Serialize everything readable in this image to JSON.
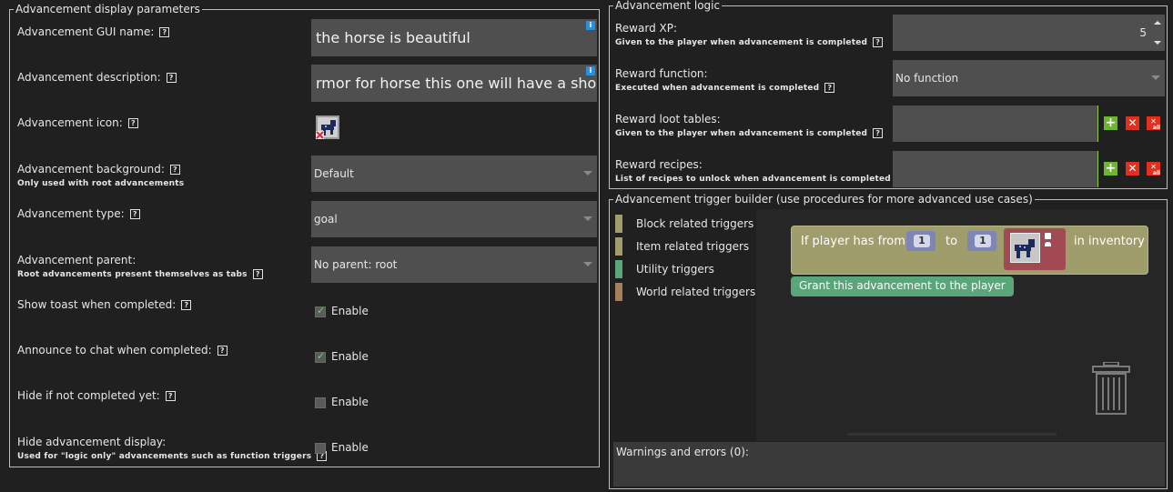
{
  "left_panel": {
    "title": "Advancement display parameters",
    "help_glyph": "?",
    "info_glyph": "i",
    "gui_name": {
      "label": "Advancement GUI name:",
      "value": "the horse is beautiful"
    },
    "description": {
      "label": "Advancement description:",
      "value": "rmor for horse this one will have a short life"
    },
    "icon": {
      "label": "Advancement icon:"
    },
    "background": {
      "label": "Advancement background:",
      "sub": "Only used with root advancements",
      "value": "Default"
    },
    "type": {
      "label": "Advancement type:",
      "value": "goal"
    },
    "parent": {
      "label": "Advancement parent:",
      "sub": "Root advancements present themselves as tabs",
      "value": "No parent: root"
    },
    "show_toast": {
      "label": "Show toast when completed:",
      "check_label": "Enable",
      "checked": true
    },
    "announce_chat": {
      "label": "Announce to chat when completed:",
      "check_label": "Enable",
      "checked": true
    },
    "hide_not_completed": {
      "label": "Hide if not completed yet:",
      "check_label": "Enable",
      "checked": false
    },
    "hide_display": {
      "label": "Hide advancement display:",
      "sub": "Used for \"logic only\" advancements such as function triggers",
      "check_label": "Enable",
      "checked": false
    }
  },
  "logic_panel": {
    "title": "Advancement logic",
    "reward_xp": {
      "label": "Reward XP:",
      "sub": "Given to the player when advancement is completed",
      "value": "5"
    },
    "reward_function": {
      "label": "Reward function:",
      "sub": "Executed when advancement is completed",
      "value": "No function"
    },
    "reward_loot": {
      "label": "Reward loot tables:",
      "sub": "Given to the player when advancement is completed"
    },
    "reward_recipes": {
      "label": "Reward recipes:",
      "sub": "List of recipes to unlock when advancement is completed"
    },
    "list_buttons": {
      "add": "+",
      "remove": "✕",
      "remove_all_small": "all"
    }
  },
  "trigger_panel": {
    "title": "Advancement trigger builder (use procedures for more advanced use cases)",
    "categories": [
      {
        "label": "Block related triggers",
        "color": "#a09d6c"
      },
      {
        "label": "Item related triggers",
        "color": "#a09d6c"
      },
      {
        "label": "Utility triggers",
        "color": "#5ba57a"
      },
      {
        "label": "World related triggers",
        "color": "#a57e5b"
      }
    ],
    "block": {
      "prefix": "If player has from",
      "from_value": "1",
      "to_label": "to",
      "to_value": "1",
      "suffix": "in inventory"
    },
    "action_block": "Grant this advancement to the player",
    "warnings": "Warnings and errors (0):"
  }
}
